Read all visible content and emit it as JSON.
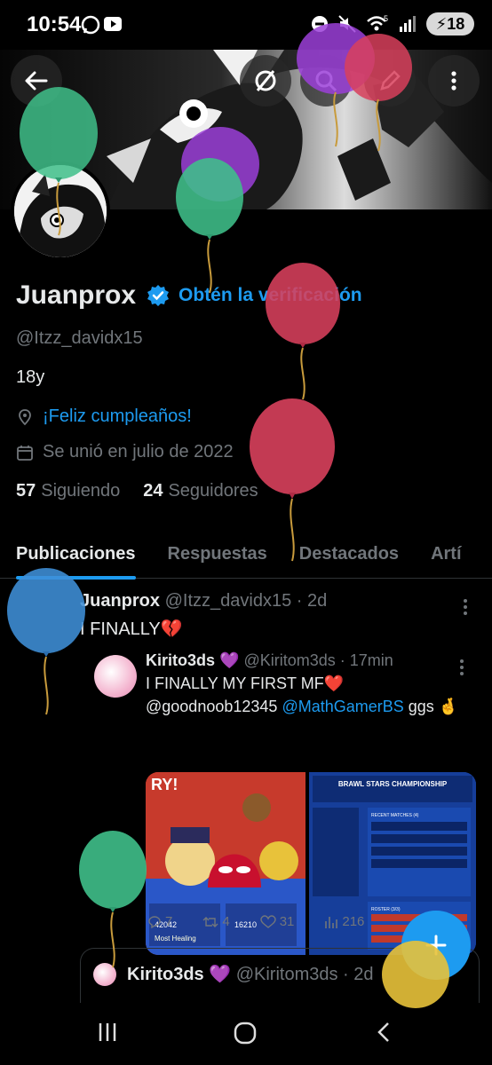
{
  "status_bar": {
    "time": "10:54",
    "battery": "18",
    "network": "5"
  },
  "profile": {
    "name": "Juanprox",
    "verify_cta": "Obtén la verificación",
    "handle": "@Itzz_davidx15",
    "bio": "18y",
    "location_link": "¡Feliz cumpleaños!",
    "joined": "Se unió en julio de 2022",
    "following_count": "57",
    "following_label": "Siguiendo",
    "followers_count": "24",
    "followers_label": "Seguidores"
  },
  "tabs": [
    {
      "label": "Publicaciones",
      "active": true
    },
    {
      "label": "Respuestas",
      "active": false
    },
    {
      "label": "Destacados",
      "active": false
    },
    {
      "label": "Artí",
      "active": false
    }
  ],
  "post": {
    "author": "Juanprox",
    "meta": "@Itzz_davidx15 · 2d",
    "text": "I FINALLY💔",
    "quote": {
      "author": "Kirito3ds 💜",
      "meta": "@Kiritom3ds · 17min",
      "line1": "I FINALLY MY FIRST MF❤️",
      "line2_a": "@goodnoob12345",
      "line2_b": "@MathGamerBS",
      "line2_c": "ggs 🤞",
      "media_left_text": "RY!",
      "media_right_title": "BRAWL STARS CHAMPIONSHIP",
      "media_left_stat1": "42042",
      "media_left_stat2": "16210",
      "media_left_tag": "Most Healing",
      "media_right_section1": "RECENT MATCHES (4)",
      "media_right_section2": "ROSTER (3/3)"
    },
    "actions": {
      "replies": "7",
      "reposts": "4",
      "likes": "31",
      "views": "216"
    },
    "quote2": {
      "author": "Kirito3ds 💜",
      "meta": "@Kiritom3ds · 2d"
    }
  },
  "colors": {
    "accent": "#1d9bf0",
    "background": "#000000",
    "text_primary": "#e7e9ea",
    "text_secondary": "#71767b",
    "balloon_green": "#3fbf8a",
    "balloon_purple": "#9b3fd8",
    "balloon_red": "#d8405c",
    "balloon_blue": "#3f8fd8",
    "balloon_yellow": "#e8c23a"
  },
  "icons": {
    "back": "arrow-left-icon",
    "grok": "slash-circle-icon",
    "search": "search-icon",
    "edit": "edit-icon",
    "more": "more-vertical-icon",
    "verified": "verified-badge-icon",
    "location": "location-icon",
    "calendar": "calendar-icon",
    "fab": "plus-icon"
  }
}
